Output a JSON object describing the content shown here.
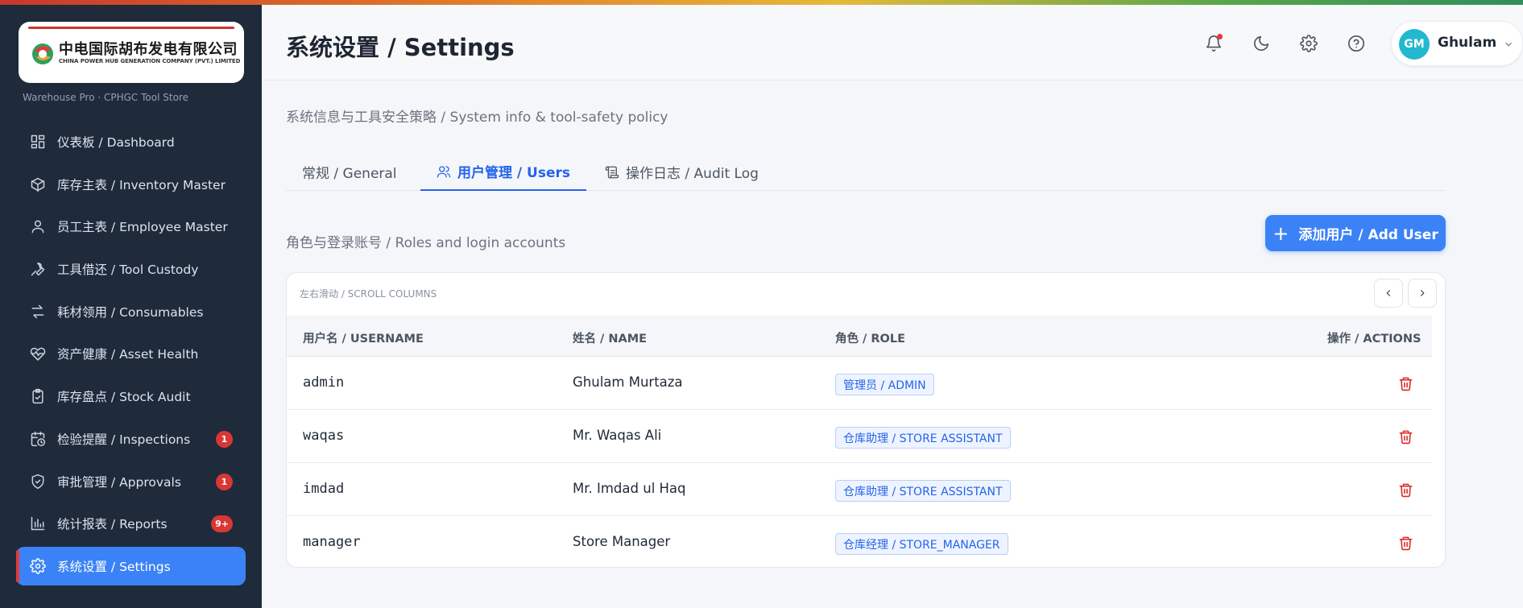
{
  "brand": {
    "company_cn": "中电国际胡布发电有限公司",
    "company_en": "CHINA POWER HUB GENERATION COMPANY (PVT.) LIMITED",
    "app_subtitle": "Warehouse Pro · CPHGC Tool Store"
  },
  "sidebar": {
    "items": [
      {
        "label": "仪表板 / Dashboard",
        "icon": "dashboard-icon"
      },
      {
        "label": "库存主表 / Inventory Master",
        "icon": "box-icon"
      },
      {
        "label": "员工主表 / Employee Master",
        "icon": "user-icon"
      },
      {
        "label": "工具借还 / Tool Custody",
        "icon": "wrench-icon"
      },
      {
        "label": "耗材领用 / Consumables",
        "icon": "swap-icon"
      },
      {
        "label": "资产健康 / Asset Health",
        "icon": "heart-pulse-icon"
      },
      {
        "label": "库存盘点 / Stock Audit",
        "icon": "clipboard-check-icon"
      },
      {
        "label": "检验提醒 / Inspections",
        "icon": "calendar-clock-icon",
        "badge": "1"
      },
      {
        "label": "审批管理 / Approvals",
        "icon": "shield-check-icon",
        "badge": "1"
      },
      {
        "label": "统计报表 / Reports",
        "icon": "bar-chart-icon",
        "badge": "9+"
      },
      {
        "label": "系统设置 / Settings",
        "icon": "gear-icon",
        "active": true
      }
    ]
  },
  "header": {
    "title": "系统设置 / Settings",
    "user_initials": "GM",
    "user_name": "Ghulam"
  },
  "main": {
    "subtitle": "系统信息与工具安全策略 / System info & tool-safety policy",
    "tabs": [
      {
        "label": "常规 / General"
      },
      {
        "label": "用户管理 / Users",
        "active": true
      },
      {
        "label": "操作日志 / Audit Log"
      }
    ],
    "section_label": "角色与登录账号 / Roles and login accounts",
    "add_button": "添加用户 / Add User",
    "scroll_label": "左右滑动 / SCROLL COLUMNS",
    "columns": {
      "username": "用户名 / USERNAME",
      "name": "姓名 / NAME",
      "role": "角色 / ROLE",
      "actions": "操作 / ACTIONS"
    },
    "users": [
      {
        "username": "admin",
        "name": "Ghulam Murtaza",
        "role": "管理员 / ADMIN"
      },
      {
        "username": "waqas",
        "name": "Mr. Waqas Ali",
        "role": "仓库助理 / STORE ASSISTANT"
      },
      {
        "username": "imdad",
        "name": "Mr. Imdad ul Haq",
        "role": "仓库助理 / STORE ASSISTANT"
      },
      {
        "username": "manager",
        "name": "Store Manager",
        "role": "仓库经理 / STORE_MANAGER"
      }
    ]
  },
  "colors": {
    "sidebar_bg": "#1f2a3b",
    "accent": "#3b82f6",
    "badge": "#d93636",
    "delete": "#dc2626",
    "avatar": "#22b8cf"
  }
}
